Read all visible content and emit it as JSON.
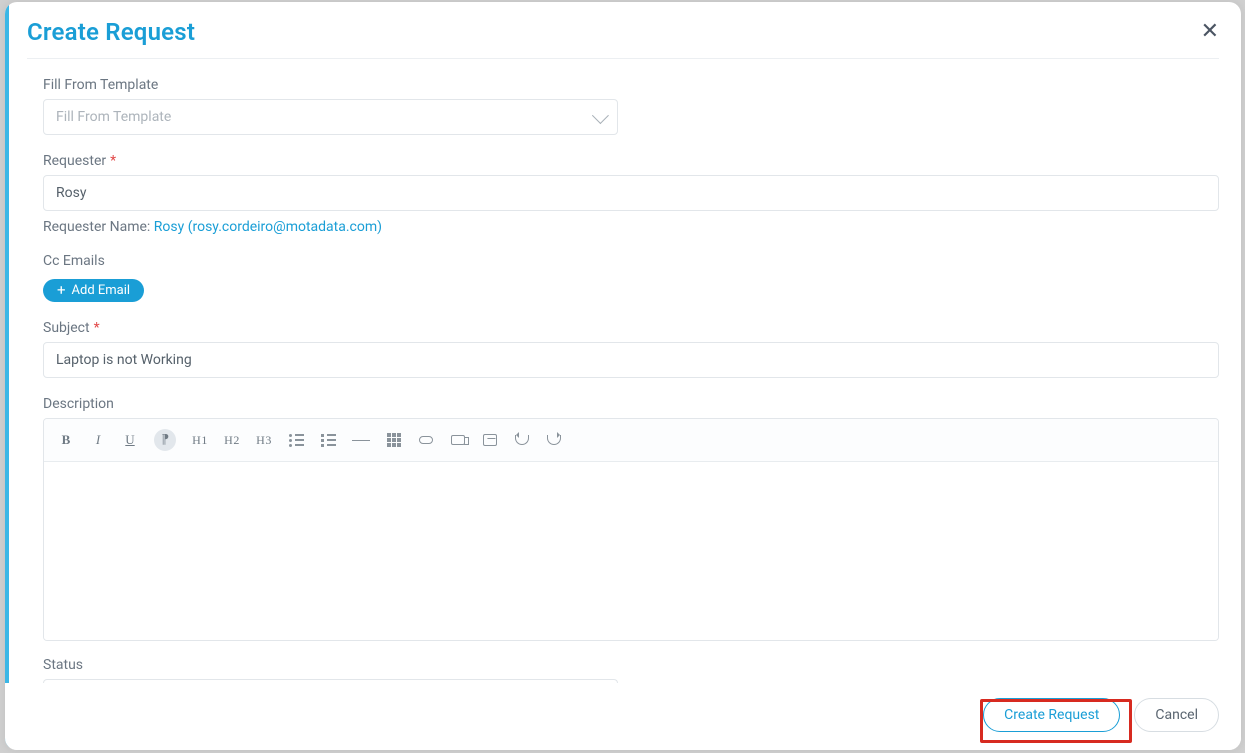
{
  "modal": {
    "title": "Create Request"
  },
  "fields": {
    "template": {
      "label": "Fill From Template",
      "placeholder": "Fill From Template"
    },
    "requester": {
      "label": "Requester",
      "value": "Rosy",
      "hint_prefix": "Requester Name: ",
      "hint_link": "Rosy (rosy.cordeiro@motadata.com)"
    },
    "cc": {
      "label": "Cc Emails",
      "add_btn": "Add Email"
    },
    "subject": {
      "label": "Subject",
      "value": "Laptop is not Working"
    },
    "description": {
      "label": "Description"
    },
    "status": {
      "label": "Status"
    }
  },
  "toolbar": {
    "bold": "B",
    "italic": "I",
    "underline": "U",
    "para": "¶",
    "h1": "H1",
    "h2": "H2",
    "h3": "H3"
  },
  "footer": {
    "primary": "Create Request",
    "cancel": "Cancel"
  }
}
